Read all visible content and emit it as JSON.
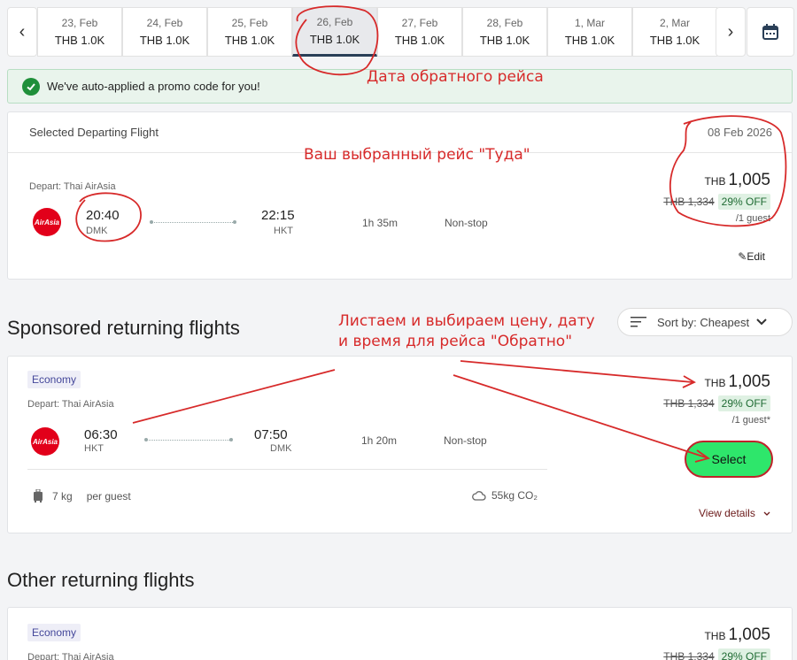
{
  "date_strip": {
    "prev_label": "‹",
    "next_label": "›",
    "tabs": [
      {
        "date": "23, Feb",
        "price": "THB 1.0K"
      },
      {
        "date": "24, Feb",
        "price": "THB 1.0K"
      },
      {
        "date": "25, Feb",
        "price": "THB 1.0K"
      },
      {
        "date": "26, Feb",
        "price": "THB 1.0K"
      },
      {
        "date": "27, Feb",
        "price": "THB 1.0K"
      },
      {
        "date": "28, Feb",
        "price": "THB 1.0K"
      },
      {
        "date": "1, Mar",
        "price": "THB 1.0K"
      },
      {
        "date": "2, Mar",
        "price": "THB 1.0K"
      }
    ],
    "active_index": 3
  },
  "promo": {
    "text": "We've auto-applied a promo code for you!"
  },
  "departing": {
    "title": "Selected Departing Flight",
    "date": "08 Feb 2026",
    "airline_label": "Depart: Thai AirAsia",
    "logo_text": "AirAsia",
    "dep_time": "20:40",
    "dep_code": "DMK",
    "arr_time": "22:15",
    "arr_code": "HKT",
    "duration": "1h 35m",
    "stops": "Non-stop",
    "currency": "THB",
    "price": "1,005",
    "old_price": "THB 1,334",
    "discount": "29% OFF",
    "guest": "/1 guest",
    "edit_label": "Edit"
  },
  "sponsored_title": "Sponsored returning flights",
  "sort": {
    "label": "Sort by:",
    "value": "Cheapest"
  },
  "returning": {
    "badge": "Economy",
    "airline_label": "Depart: Thai AirAsia",
    "logo_text": "AirAsia",
    "dep_time": "06:30",
    "dep_code": "HKT",
    "arr_time": "07:50",
    "arr_code": "DMK",
    "duration": "1h 20m",
    "stops": "Non-stop",
    "currency": "THB",
    "price": "1,005",
    "old_price": "THB 1,334",
    "discount": "29% OFF",
    "guest": "/1 guest*",
    "baggage": "7 kg",
    "baggage_suffix": "per guest",
    "co2": "55kg CO₂",
    "select_label": "Select",
    "details_label": "View details"
  },
  "other_title": "Other returning flights",
  "other": {
    "badge": "Economy",
    "airline_label": "Depart: Thai AirAsia",
    "currency": "THB",
    "price": "1,005",
    "old_price": "THB 1,334",
    "discount": "29% OFF"
  },
  "annotations": {
    "return_date": "Дата обратного рейса",
    "selected": "Ваш выбранный рейс \"Туда\"",
    "browse": "Листаем и выбираем цену, дату и время для рейса \"Обратно\""
  },
  "colors": {
    "annotation": "#d72a2a",
    "select_button": "#2ee66b",
    "promo_bg": "#e9f4ec",
    "accent_underline": "#2a3f57"
  }
}
